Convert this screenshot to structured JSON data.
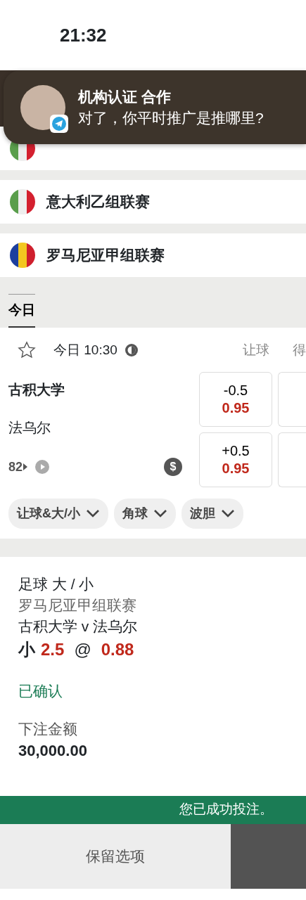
{
  "status_bar": {
    "time": "21:32"
  },
  "notification": {
    "title": "机构认证 合作",
    "message": "对了，你平时推广是推哪里?"
  },
  "leagues": [
    {
      "kind": "italy"
    },
    {
      "name": "意大利乙组联赛",
      "kind": "italy"
    },
    {
      "name": "罗马尼亚甲组联赛",
      "kind": "romania"
    }
  ],
  "date_tabs": [
    {
      "label": "今日",
      "selected": true
    }
  ],
  "match": {
    "favorite": false,
    "time": "今日 10:30",
    "market_headers": [
      "让球",
      "得"
    ],
    "home": "古积大学",
    "away": "法乌尔",
    "more_markets": "82",
    "cash_out_icon": "$",
    "handicap_odds": [
      {
        "line": "-0.5",
        "price": "0.95"
      },
      {
        "line": "+0.5",
        "price": "0.95"
      }
    ]
  },
  "market_filters": [
    "让球&大/小",
    "角球",
    "波胆"
  ],
  "receipt": {
    "market": "足球 大 / 小",
    "league": "罗马尼亚甲组联赛",
    "event": "古积大学 v 法乌尔",
    "selection": "小",
    "line": "2.5",
    "at": "@",
    "odds": "0.88",
    "status": "已确认",
    "stake_label": "下注金额",
    "stake": "30,000.00"
  },
  "toast": "您已成功投注。",
  "actions": [
    "保留选项"
  ]
}
